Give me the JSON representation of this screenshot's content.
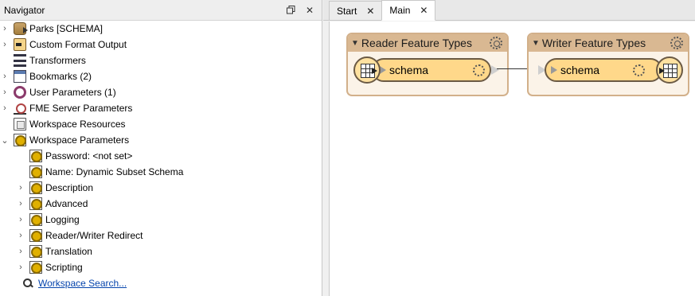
{
  "navigator": {
    "title": "Navigator",
    "float_icon": "restore-icon",
    "close_label": "✕",
    "items": [
      {
        "label": "Parks [SCHEMA]",
        "icon": "reader-dataset-icon",
        "expandable": true,
        "level": 0
      },
      {
        "label": "Custom Format Output",
        "icon": "custom-format-icon",
        "expandable": true,
        "level": 0
      },
      {
        "label": "Transformers",
        "icon": "transformers-icon",
        "expandable": false,
        "level": 0
      },
      {
        "label": "Bookmarks (2)",
        "icon": "bookmark-icon",
        "expandable": true,
        "level": 0
      },
      {
        "label": "User Parameters (1)",
        "icon": "gear-icon",
        "expandable": true,
        "level": 0
      },
      {
        "label": "FME Server Parameters",
        "icon": "fme-server-icon",
        "expandable": true,
        "level": 0
      },
      {
        "label": "Workspace Resources",
        "icon": "resources-icon",
        "expandable": false,
        "level": 0
      },
      {
        "label": "Workspace Parameters",
        "icon": "workspace-parameter-icon",
        "expandable": true,
        "expanded": true,
        "level": 0
      },
      {
        "label": "Password: <not set>",
        "icon": "workspace-parameter-icon",
        "expandable": false,
        "level": 1
      },
      {
        "label": "Name: Dynamic Subset Schema",
        "icon": "workspace-parameter-icon",
        "expandable": false,
        "level": 1
      },
      {
        "label": "Description",
        "icon": "workspace-parameter-icon",
        "expandable": true,
        "level": 1
      },
      {
        "label": "Advanced",
        "icon": "workspace-parameter-icon",
        "expandable": true,
        "level": 1
      },
      {
        "label": "Logging",
        "icon": "workspace-parameter-icon",
        "expandable": true,
        "level": 1
      },
      {
        "label": "Reader/Writer Redirect",
        "icon": "workspace-parameter-icon",
        "expandable": true,
        "level": 1
      },
      {
        "label": "Translation",
        "icon": "workspace-parameter-icon",
        "expandable": true,
        "level": 1
      },
      {
        "label": "Scripting",
        "icon": "workspace-parameter-icon",
        "expandable": true,
        "level": 1
      }
    ],
    "search_link": "Workspace Search..."
  },
  "tabs": [
    {
      "label": "Start",
      "close": "✕",
      "active": false
    },
    {
      "label": "Main",
      "close": "✕",
      "active": true
    }
  ],
  "canvas": {
    "reader": {
      "title": "Reader Feature Types",
      "feature": "schema"
    },
    "writer": {
      "title": "Writer Feature Types",
      "feature": "schema"
    }
  },
  "colors": {
    "feature_box_header": "#d9b892",
    "feature_node_fill": "#ffd88a",
    "link": "#0645ad"
  }
}
